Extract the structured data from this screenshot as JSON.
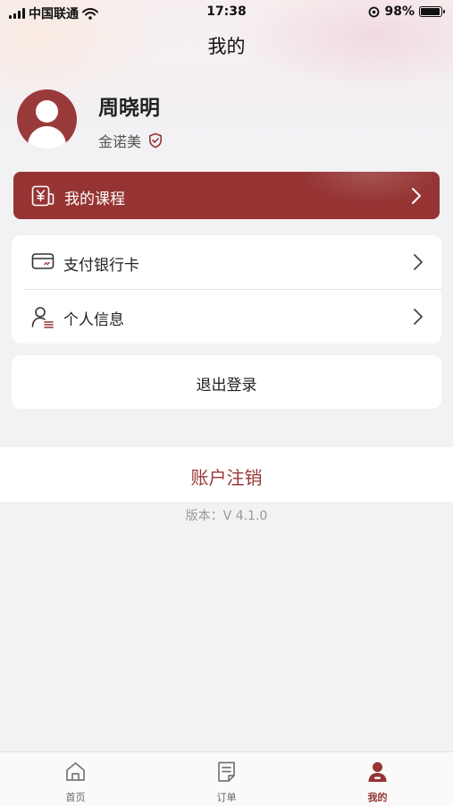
{
  "status_bar": {
    "carrier": "中国联通",
    "time": "17:38",
    "battery": "98%",
    "battery_level": 0.98
  },
  "header": {
    "title": "我的"
  },
  "profile": {
    "name": "周晓明",
    "org": "金诺美"
  },
  "course": {
    "label": "我的课程"
  },
  "menu": {
    "items": [
      {
        "label": "支付银行卡"
      },
      {
        "label": "个人信息"
      }
    ]
  },
  "logout": {
    "label": "退出登录"
  },
  "account_cancel": {
    "label": "账户注销"
  },
  "version": {
    "text": "版本：V 4.1.0"
  },
  "tabs": [
    {
      "label": "首页",
      "active": false
    },
    {
      "label": "订单",
      "active": false
    },
    {
      "label": "我的",
      "active": true
    }
  ],
  "colors": {
    "accent": "#963434",
    "background": "#f2f2f5"
  }
}
